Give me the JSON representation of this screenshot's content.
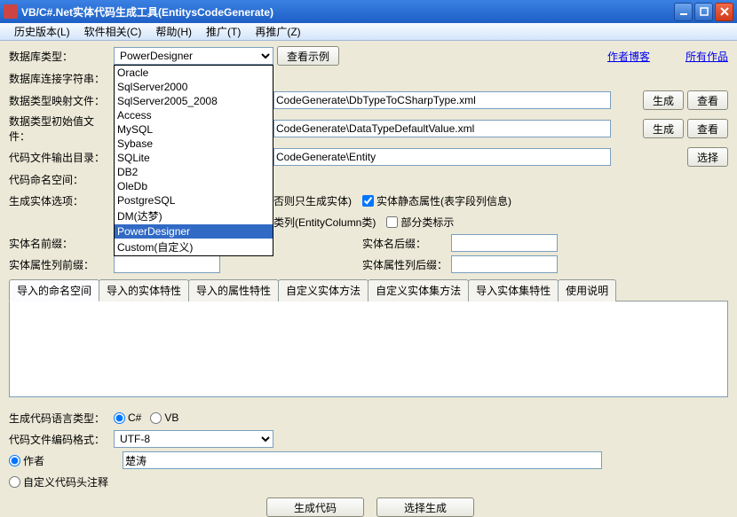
{
  "title": "VB/C#.Net实体代码生成工具(EntitysCodeGenerate)",
  "menu": [
    "历史版本(L)",
    "软件相关(C)",
    "帮助(H)",
    "推广(T)",
    "再推广(Z)"
  ],
  "labels": {
    "dbtype": "数据库类型：",
    "connstr": "数据库连接字符串：",
    "typemap": "数据类型映射文件：",
    "initval": "数据类型初始值文件：",
    "outdir": "代码文件输出目录：",
    "ns": "代码命名空间：",
    "opts": "生成实体选项：",
    "prefix": "实体名前缀：",
    "suffix": "实体名后缀：",
    "propprefix": "实体属性列前缀：",
    "propsuffix": "实体属性列后缀：",
    "langtype": "生成代码语言类型：",
    "encoding": "代码文件编码格式：",
    "author": "作者",
    "customhdr": "自定义代码头注释"
  },
  "dbtype_selected": "PowerDesigner",
  "dbtype_options": [
    "Oracle",
    "SqlServer2000",
    "SqlServer2005_2008",
    "Access",
    "MySQL",
    "Sybase",
    "SQLite",
    "DB2",
    "OleDb",
    "PostgreSQL",
    "DM(达梦)",
    "PowerDesigner",
    "Custom(自定义)"
  ],
  "btn_sample": "查看示例",
  "link_blog": "作者博客",
  "link_works": "所有作品",
  "txt_typemap": "CodeGenerate\\DbTypeToCSharpType.xml",
  "txt_initval": "CodeGenerate\\DataTypeDefaultValue.xml",
  "txt_outdir": "CodeGenerate\\Entity",
  "btn_gen": "生成",
  "btn_view": "查看",
  "btn_select": "选择",
  "opt_onlyentity": "否则只生成实体)",
  "opt_static": "实体静态属性(表字段列信息)",
  "opt_entitycol": "类列(EntityColumn类)",
  "opt_partial": "部分类标示",
  "tabs": [
    "导入的命名空间",
    "导入的实体特性",
    "导入的属性特性",
    "自定义实体方法",
    "自定义实体集方法",
    "导入实体集特性",
    "使用说明"
  ],
  "lang_cs": "C#",
  "lang_vb": "VB",
  "encoding_val": "UTF-8",
  "author_val": "楚涛",
  "btn_gencode": "生成代码",
  "btn_selgen": "选择生成"
}
